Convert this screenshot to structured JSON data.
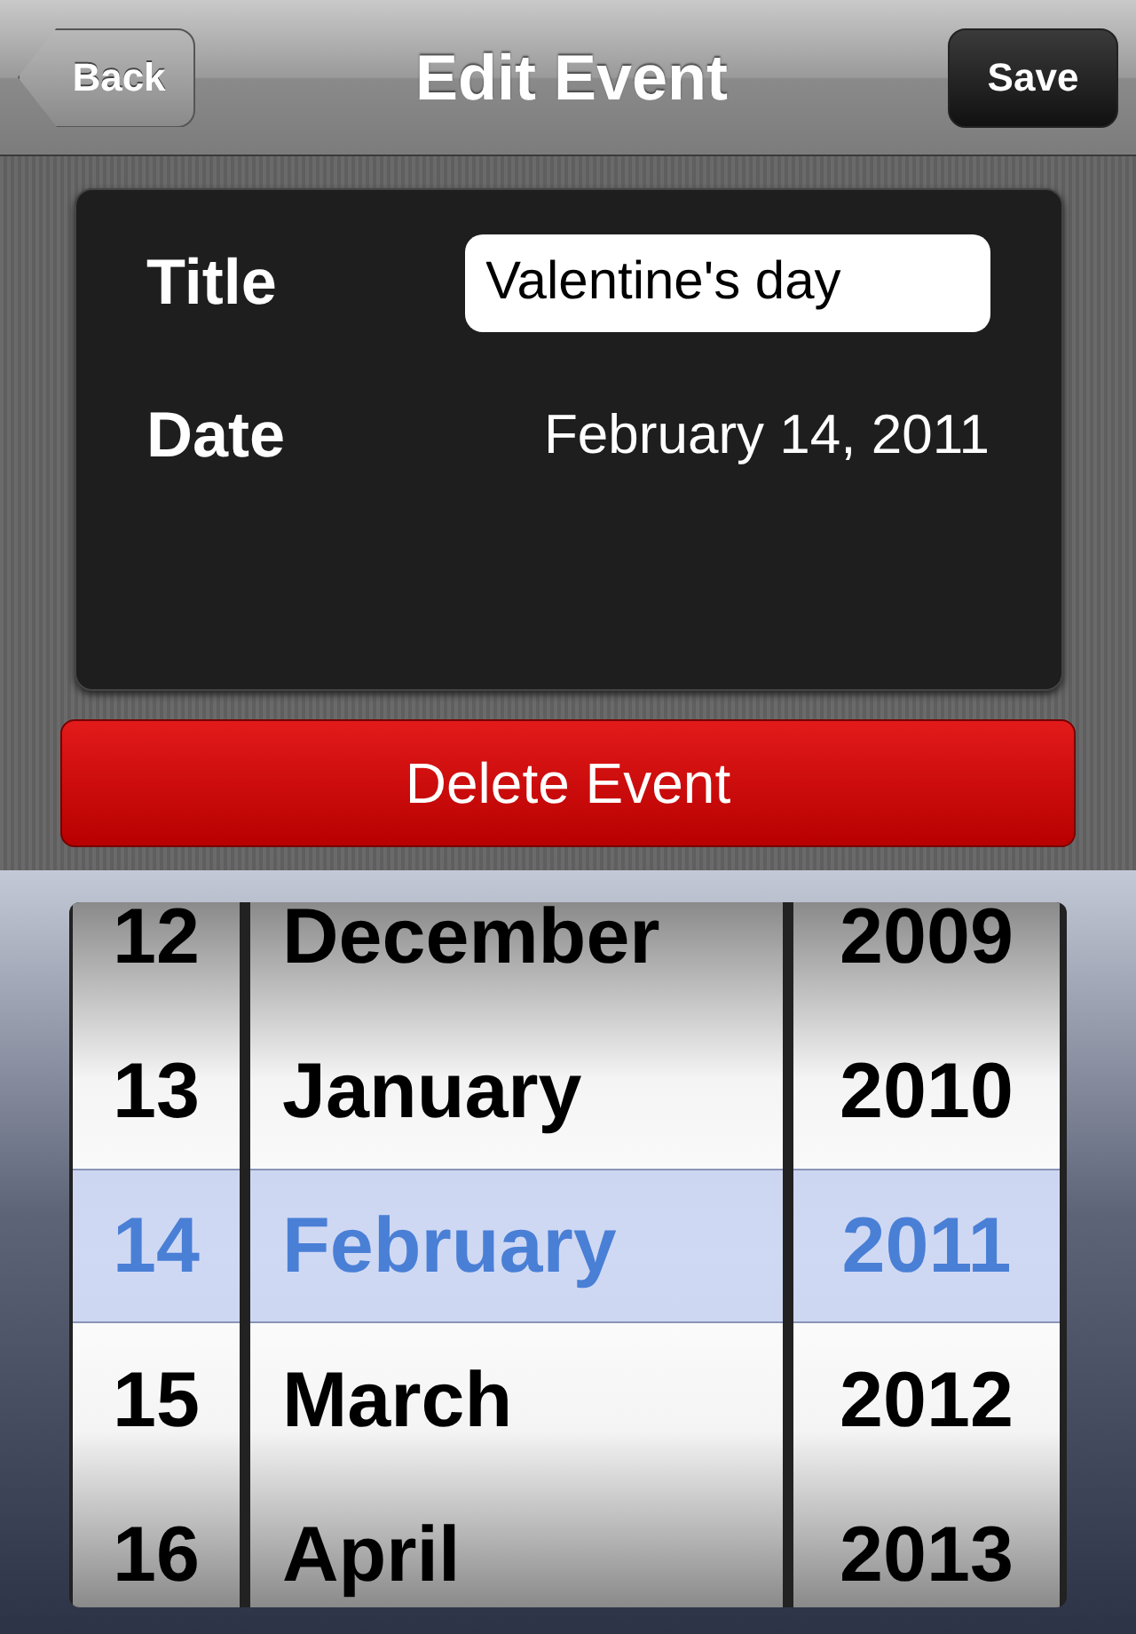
{
  "nav": {
    "back": "Back",
    "title": "Edit Event",
    "save": "Save"
  },
  "form": [
    {
      "label": "Title",
      "kind": "input",
      "value": "Valentine's day"
    },
    {
      "label": "Date",
      "kind": "text",
      "value": "February 14, 2011"
    }
  ],
  "delete_button": "Delete Event",
  "picker": {
    "columns": [
      {
        "kind": "day",
        "items": [
          {
            "label": "12",
            "selected": false
          },
          {
            "label": "13",
            "selected": false
          },
          {
            "label": "14",
            "selected": true
          },
          {
            "label": "15",
            "selected": false
          },
          {
            "label": "16",
            "selected": false
          }
        ]
      },
      {
        "kind": "month",
        "items": [
          {
            "label": "December",
            "selected": false
          },
          {
            "label": "January",
            "selected": false
          },
          {
            "label": "February",
            "selected": true
          },
          {
            "label": "March",
            "selected": false
          },
          {
            "label": "April",
            "selected": false
          }
        ]
      },
      {
        "kind": "year",
        "items": [
          {
            "label": "2009",
            "selected": false
          },
          {
            "label": "2010",
            "selected": false
          },
          {
            "label": "2011",
            "selected": true
          },
          {
            "label": "2012",
            "selected": false
          },
          {
            "label": "2013",
            "selected": false
          }
        ]
      }
    ]
  }
}
